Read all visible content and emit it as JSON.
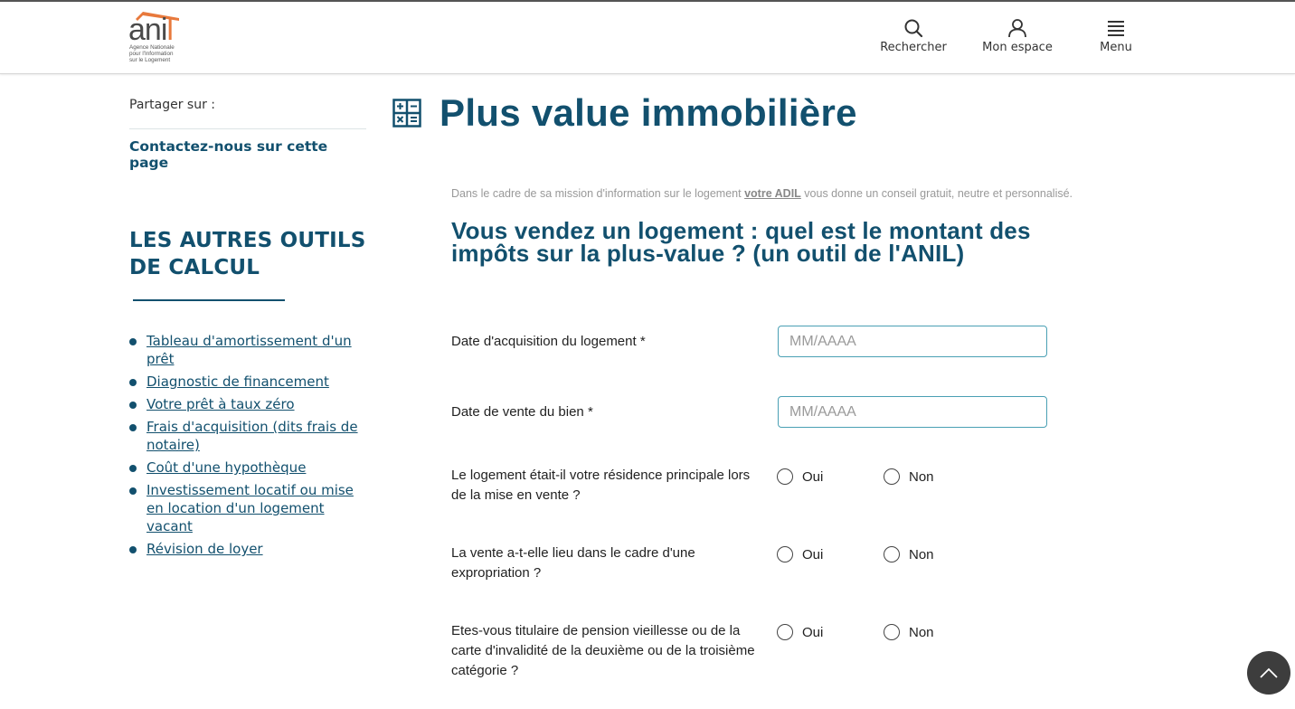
{
  "brand": {
    "logo_word": "ani",
    "logo_word_accent": "l",
    "logo_sub": [
      "Agence Nationale",
      "pour l'Information",
      "sur le Logement"
    ],
    "primary_color": "#12506e",
    "accent_color": "#e8793c"
  },
  "header": {
    "nav": [
      {
        "label": "Rechercher",
        "icon": "search-icon"
      },
      {
        "label": "Mon espace",
        "icon": "user-icon"
      },
      {
        "label": "Menu",
        "icon": "hamburger-menu-icon"
      }
    ]
  },
  "sidebar": {
    "share_label": "Partager sur :",
    "contact_link": "Contactez-nous sur cette page",
    "tools_title": "LES AUTRES OUTILS DE CALCUL",
    "tools": [
      "Tableau d'amortissement d'un prêt",
      "Diagnostic de financement",
      "Votre prêt à taux zéro",
      "Frais d'acquisition (dits frais de notaire)",
      "Coût d'une hypothèque",
      "Investissement locatif ou mise en location d'un logement vacant",
      "Révision de loyer"
    ]
  },
  "main": {
    "page_title": "Plus value immobilière",
    "title_icon": "calculator-icon",
    "intro_before": "Dans le cadre de sa mission d'information sur le logement ",
    "intro_link": "votre ADIL",
    "intro_after": " vous donne un conseil gratuit, neutre et personnalisé.",
    "question_title": "Vous vendez un logement : quel est le montant des impôts sur la plus-value ? (un outil de l'ANIL)",
    "form": {
      "acquisition_date": {
        "label": "Date d'acquisition du logement *",
        "placeholder": "MM/AAAA",
        "value": ""
      },
      "sale_date": {
        "label": "Date de vente du bien *",
        "placeholder": "MM/AAAA",
        "value": ""
      },
      "questions": [
        {
          "label": "Le logement était-il votre résidence principale lors de la mise en vente ?",
          "options": [
            "Oui",
            "Non"
          ],
          "selected": null
        },
        {
          "label": "La vente a-t-elle lieu dans le cadre d'une expropriation ?",
          "options": [
            "Oui",
            "Non"
          ],
          "selected": null
        },
        {
          "label": "Etes-vous titulaire de pension vieillesse ou de la carte d'invalidité de la deuxième ou de la troisième catégorie ?",
          "options": [
            "Oui",
            "Non"
          ],
          "selected": null
        }
      ]
    }
  },
  "scroll_top": {
    "icon": "chevron-up-icon"
  }
}
